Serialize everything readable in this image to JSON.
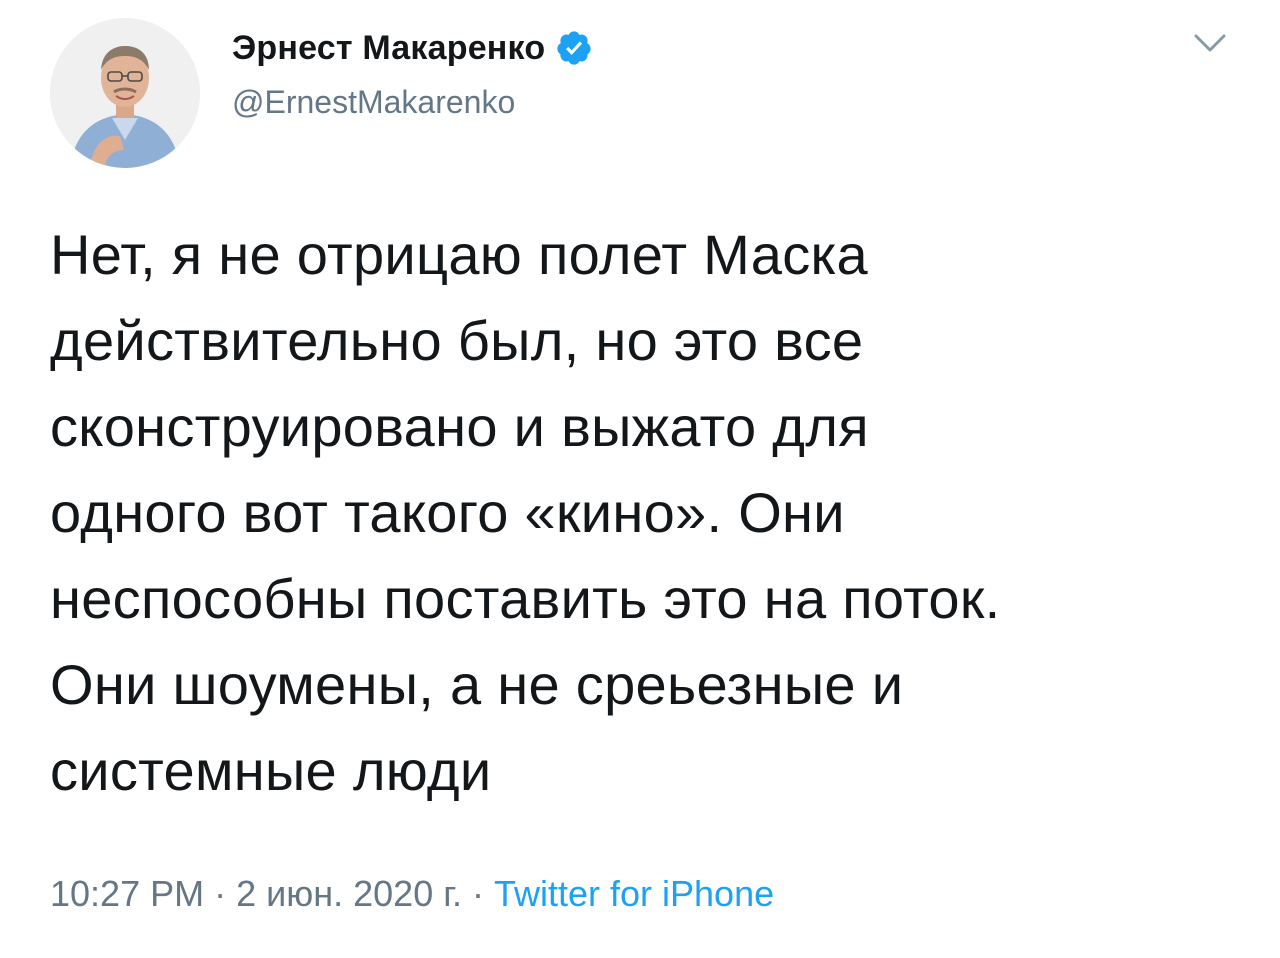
{
  "author": {
    "display_name": "Эрнест Макаренко",
    "handle": "@ErnestMakarenko",
    "verified": true,
    "avatar_icon": "person-photo"
  },
  "tweet": {
    "text": "Нет, я не отрицаю полет Маска\nдействительно был, но это все\nсконструировано и выжато для\nодного вот такого «кино». Они\nнеспособны поставить это на поток.\nОни шоумены, а не среьезные и\nсистемные люди",
    "time": "10:27 PM",
    "separator": "·",
    "date": "2 июн. 2020 г.",
    "source": "Twitter for iPhone"
  },
  "colors": {
    "text": "#14171a",
    "secondary": "#657786",
    "accent": "#1da1f2"
  },
  "icons": {
    "verified": "verified-badge-icon",
    "menu": "chevron-down-icon"
  }
}
